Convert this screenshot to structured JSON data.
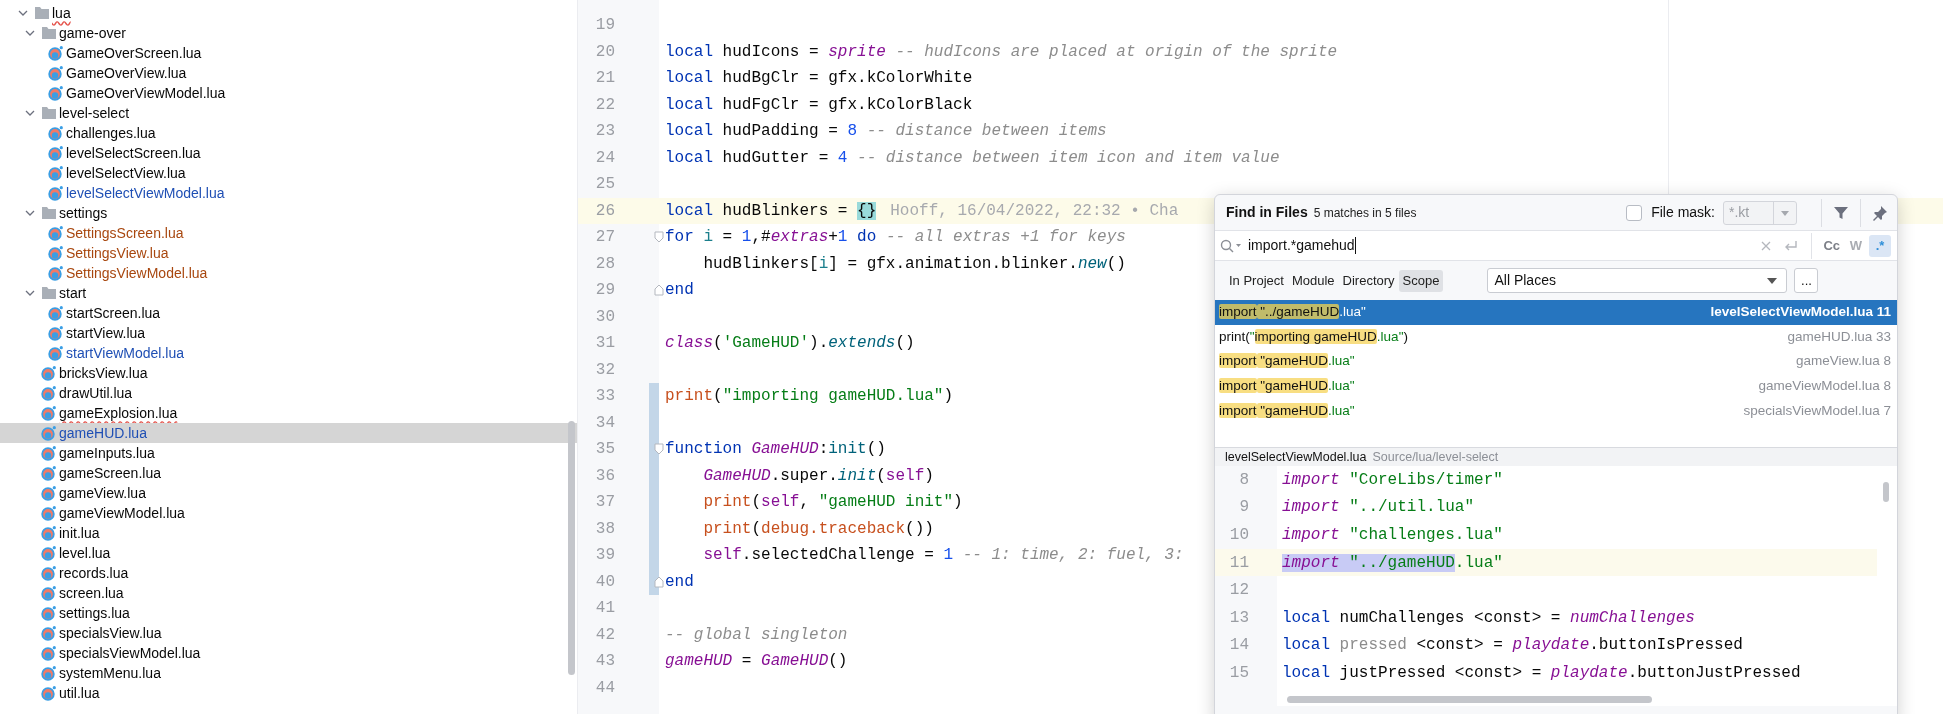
{
  "project_tree": [
    {
      "label": "lua",
      "kind": "folder",
      "expanded": true,
      "color": "#080808",
      "typo": true,
      "selected": false,
      "children": [
        {
          "label": "game-over",
          "kind": "folder",
          "expanded": true,
          "color": "#080808",
          "typo": false,
          "selected": false,
          "children": [
            {
              "label": "GameOverScreen.lua",
              "kind": "file",
              "color": "#080808",
              "typo": false,
              "selected": false
            },
            {
              "label": "GameOverView.lua",
              "kind": "file",
              "color": "#080808",
              "typo": false,
              "selected": false
            },
            {
              "label": "GameOverViewModel.lua",
              "kind": "file",
              "color": "#080808",
              "typo": false,
              "selected": false
            }
          ]
        },
        {
          "label": "level-select",
          "kind": "folder",
          "expanded": true,
          "color": "#080808",
          "typo": false,
          "selected": false,
          "children": [
            {
              "label": "challenges.lua",
              "kind": "file",
              "color": "#080808",
              "typo": false,
              "selected": false
            },
            {
              "label": "levelSelectScreen.lua",
              "kind": "file",
              "color": "#080808",
              "typo": false,
              "selected": false
            },
            {
              "label": "levelSelectView.lua",
              "kind": "file",
              "color": "#080808",
              "typo": false,
              "selected": false
            },
            {
              "label": "levelSelectViewModel.lua",
              "kind": "file",
              "color": "#1f4fb4",
              "typo": false,
              "selected": false
            }
          ]
        },
        {
          "label": "settings",
          "kind": "folder",
          "expanded": true,
          "color": "#080808",
          "typo": false,
          "selected": false,
          "children": [
            {
              "label": "SettingsScreen.lua",
              "kind": "file",
              "color": "#a8470f",
              "typo": false,
              "selected": false
            },
            {
              "label": "SettingsView.lua",
              "kind": "file",
              "color": "#a8470f",
              "typo": false,
              "selected": false
            },
            {
              "label": "SettingsViewModel.lua",
              "kind": "file",
              "color": "#a8470f",
              "typo": false,
              "selected": false
            }
          ]
        },
        {
          "label": "start",
          "kind": "folder",
          "expanded": true,
          "color": "#080808",
          "typo": false,
          "selected": false,
          "children": [
            {
              "label": "startScreen.lua",
              "kind": "file",
              "color": "#080808",
              "typo": false,
              "selected": false
            },
            {
              "label": "startView.lua",
              "kind": "file",
              "color": "#080808",
              "typo": false,
              "selected": false
            },
            {
              "label": "startViewModel.lua",
              "kind": "file",
              "color": "#1f4fb4",
              "typo": false,
              "selected": false
            }
          ]
        },
        {
          "label": "bricksView.lua",
          "kind": "file",
          "color": "#080808",
          "typo": false,
          "selected": false
        },
        {
          "label": "drawUtil.lua",
          "kind": "file",
          "color": "#080808",
          "typo": false,
          "selected": false
        },
        {
          "label": "gameExplosion.lua",
          "kind": "file",
          "color": "#080808",
          "typo": true,
          "selected": false
        },
        {
          "label": "gameHUD.lua",
          "kind": "file",
          "color": "#1f4fb4",
          "typo": false,
          "selected": true
        },
        {
          "label": "gameInputs.lua",
          "kind": "file",
          "color": "#080808",
          "typo": false,
          "selected": false
        },
        {
          "label": "gameScreen.lua",
          "kind": "file",
          "color": "#080808",
          "typo": false,
          "selected": false
        },
        {
          "label": "gameView.lua",
          "kind": "file",
          "color": "#080808",
          "typo": false,
          "selected": false
        },
        {
          "label": "gameViewModel.lua",
          "kind": "file",
          "color": "#080808",
          "typo": false,
          "selected": false
        },
        {
          "label": "init.lua",
          "kind": "file",
          "color": "#080808",
          "typo": false,
          "selected": false
        },
        {
          "label": "level.lua",
          "kind": "file",
          "color": "#080808",
          "typo": false,
          "selected": false
        },
        {
          "label": "records.lua",
          "kind": "file",
          "color": "#080808",
          "typo": false,
          "selected": false
        },
        {
          "label": "screen.lua",
          "kind": "file",
          "color": "#080808",
          "typo": false,
          "selected": false
        },
        {
          "label": "settings.lua",
          "kind": "file",
          "color": "#080808",
          "typo": false,
          "selected": false
        },
        {
          "label": "specialsView.lua",
          "kind": "file",
          "color": "#080808",
          "typo": false,
          "selected": false
        },
        {
          "label": "specialsViewModel.lua",
          "kind": "file",
          "color": "#080808",
          "typo": false,
          "selected": false
        },
        {
          "label": "systemMenu.lua",
          "kind": "file",
          "color": "#080808",
          "typo": false,
          "selected": false
        },
        {
          "label": "util.lua",
          "kind": "file",
          "color": "#080808",
          "typo": false,
          "selected": false
        }
      ]
    }
  ],
  "editor": {
    "lines": [
      {
        "number": "19",
        "current": false,
        "changed": false
      },
      {
        "number": "20",
        "current": false,
        "changed": false,
        "tokens": [
          {
            "kind": "keyword",
            "text": "local"
          },
          {
            "kind": "plain",
            "text": " hudIcons = "
          },
          {
            "kind": "global",
            "text": "sprite"
          },
          {
            "kind": "comment",
            "text": " -- hudIcons are placed at origin of the sprite"
          }
        ]
      },
      {
        "number": "21",
        "current": false,
        "changed": false,
        "tokens": [
          {
            "kind": "keyword",
            "text": "local"
          },
          {
            "kind": "plain",
            "text": " hudBgClr = gfx.kColorWhite"
          }
        ]
      },
      {
        "number": "22",
        "current": false,
        "changed": false,
        "tokens": [
          {
            "kind": "keyword",
            "text": "local"
          },
          {
            "kind": "plain",
            "text": " hudFgClr = gfx.kColorBlack"
          }
        ]
      },
      {
        "number": "23",
        "current": false,
        "changed": false,
        "tokens": [
          {
            "kind": "keyword",
            "text": "local"
          },
          {
            "kind": "plain",
            "text": " hudPadding = "
          },
          {
            "kind": "number",
            "text": "8"
          },
          {
            "kind": "comment",
            "text": " -- distance between items"
          }
        ]
      },
      {
        "number": "24",
        "current": false,
        "changed": false,
        "tokens": [
          {
            "kind": "keyword",
            "text": "local"
          },
          {
            "kind": "plain",
            "text": " hudGutter = "
          },
          {
            "kind": "number",
            "text": "4"
          },
          {
            "kind": "comment",
            "text": " -- distance between item icon and item value"
          }
        ]
      },
      {
        "number": "25",
        "current": false,
        "changed": false
      },
      {
        "number": "26",
        "current": true,
        "changed": false,
        "annotation": "Hooff, 16/04/2022, 22:32 • Cha",
        "tokens": [
          {
            "kind": "keyword",
            "text": "local"
          },
          {
            "kind": "plain",
            "text": " hudBlinkers = "
          },
          {
            "kind": "brace",
            "text": "{}"
          }
        ]
      },
      {
        "number": "27",
        "current": false,
        "changed": false,
        "fold_start": true,
        "fold_end": false,
        "tokens": [
          {
            "kind": "keyword",
            "text": "for"
          },
          {
            "kind": "local",
            "text": " i"
          },
          {
            "kind": "plain",
            "text": " = "
          },
          {
            "kind": "number",
            "text": "1"
          },
          {
            "kind": "plain",
            "text": ",#"
          },
          {
            "kind": "global",
            "text": "extras"
          },
          {
            "kind": "plain",
            "text": "+"
          },
          {
            "kind": "number",
            "text": "1"
          },
          {
            "kind": "keyword",
            "text": " do"
          },
          {
            "kind": "comment",
            "text": " -- all extras +1 for keys"
          }
        ]
      },
      {
        "number": "28",
        "current": false,
        "changed": false,
        "tokens": [
          {
            "kind": "plain",
            "text": "    hudBlinkers["
          },
          {
            "kind": "local",
            "text": "i"
          },
          {
            "kind": "plain",
            "text": "] = gfx.animation.blinker."
          },
          {
            "kind": "method",
            "text": "new"
          },
          {
            "kind": "plain",
            "text": "()"
          }
        ]
      },
      {
        "number": "29",
        "current": false,
        "changed": false,
        "fold_start": false,
        "fold_end": true,
        "tokens": [
          {
            "kind": "keyword",
            "text": "end"
          }
        ]
      },
      {
        "number": "30",
        "current": false,
        "changed": false
      },
      {
        "number": "31",
        "current": false,
        "changed": false,
        "tokens": [
          {
            "kind": "global",
            "text": "class"
          },
          {
            "kind": "plain",
            "text": "("
          },
          {
            "kind": "string",
            "text": "'GameHUD'"
          },
          {
            "kind": "plain",
            "text": ")."
          },
          {
            "kind": "method",
            "text": "extends"
          },
          {
            "kind": "plain",
            "text": "()"
          }
        ]
      },
      {
        "number": "32",
        "current": false,
        "changed": false
      },
      {
        "number": "33",
        "current": false,
        "changed": true,
        "tokens": [
          {
            "kind": "builtin",
            "text": "print"
          },
          {
            "kind": "plain",
            "text": "("
          },
          {
            "kind": "string",
            "text": "\"importing gameHUD.lua\""
          },
          {
            "kind": "plain",
            "text": ")"
          }
        ]
      },
      {
        "number": "34",
        "current": false,
        "changed": true
      },
      {
        "number": "35",
        "current": false,
        "changed": true,
        "fold_start": true,
        "fold_end": false,
        "tokens": [
          {
            "kind": "keyword",
            "text": "function"
          },
          {
            "kind": "global",
            "text": " GameHUD"
          },
          {
            "kind": "plain",
            "text": ":"
          },
          {
            "kind": "function",
            "text": "init"
          },
          {
            "kind": "plain",
            "text": "()"
          }
        ]
      },
      {
        "number": "36",
        "current": false,
        "changed": true,
        "tokens": [
          {
            "kind": "global",
            "text": "    GameHUD"
          },
          {
            "kind": "plain",
            "text": ".super."
          },
          {
            "kind": "method",
            "text": "init"
          },
          {
            "kind": "plain",
            "text": "("
          },
          {
            "kind": "self",
            "text": "self"
          },
          {
            "kind": "plain",
            "text": ")"
          }
        ]
      },
      {
        "number": "37",
        "current": false,
        "changed": true,
        "tokens": [
          {
            "kind": "builtin",
            "text": "    print"
          },
          {
            "kind": "plain",
            "text": "("
          },
          {
            "kind": "self",
            "text": "self"
          },
          {
            "kind": "plain",
            "text": ", "
          },
          {
            "kind": "string",
            "text": "\"gameHUD init\""
          },
          {
            "kind": "plain",
            "text": ")"
          }
        ]
      },
      {
        "number": "38",
        "current": false,
        "changed": true,
        "tokens": [
          {
            "kind": "builtin",
            "text": "    print"
          },
          {
            "kind": "plain",
            "text": "("
          },
          {
            "kind": "builtin",
            "text": "debug.traceback"
          },
          {
            "kind": "plain",
            "text": "())"
          }
        ]
      },
      {
        "number": "39",
        "current": false,
        "changed": true,
        "tokens": [
          {
            "kind": "self",
            "text": "    self"
          },
          {
            "kind": "plain",
            "text": ".selectedChallenge = "
          },
          {
            "kind": "number",
            "text": "1"
          },
          {
            "kind": "comment",
            "text": " -- 1: time, 2: fuel, 3:"
          }
        ]
      },
      {
        "number": "40",
        "current": false,
        "changed": true,
        "fold_start": false,
        "fold_end": true,
        "tokens": [
          {
            "kind": "keyword",
            "text": "end"
          }
        ]
      },
      {
        "number": "41",
        "current": false,
        "changed": false
      },
      {
        "number": "42",
        "current": false,
        "changed": false,
        "tokens": [
          {
            "kind": "comment",
            "text": "-- global singleton"
          }
        ]
      },
      {
        "number": "43",
        "current": false,
        "changed": false,
        "tokens": [
          {
            "kind": "global",
            "text": "gameHUD"
          },
          {
            "kind": "plain",
            "text": " = "
          },
          {
            "kind": "global",
            "text": "GameHUD"
          },
          {
            "kind": "plain",
            "text": "()"
          }
        ]
      },
      {
        "number": "44",
        "current": false,
        "changed": false
      }
    ]
  },
  "find_dialog": {
    "title": "Find in Files",
    "summary": "5 matches in 5 files",
    "file_mask": {
      "label": "File mask:",
      "checked": false,
      "value": "*.kt"
    },
    "query": "import.*gamehud",
    "options": [
      {
        "label": "Cc",
        "selected": false,
        "disabled": false
      },
      {
        "label": "W",
        "selected": false,
        "disabled": true
      },
      {
        "label": ".*",
        "selected": true,
        "disabled": false
      }
    ],
    "scopes": [
      {
        "label": "In Project",
        "selected": false
      },
      {
        "label": "Module",
        "selected": false
      },
      {
        "label": "Directory",
        "selected": false
      },
      {
        "label": "Scope",
        "selected": true
      }
    ],
    "scope_value": "All Places",
    "more_button": "...",
    "results": [
      {
        "selected": true,
        "location": "levelSelectViewModel.lua 11",
        "segments": [
          {
            "kind": "match",
            "text": "import"
          },
          {
            "kind": "match",
            "text": " \"../gameHUD"
          },
          {
            "kind": "string",
            "text": ".lua\""
          }
        ]
      },
      {
        "selected": false,
        "location": "gameHUD.lua 33",
        "segments": [
          {
            "kind": "code",
            "text": "print("
          },
          {
            "kind": "string",
            "text": "\""
          },
          {
            "kind": "match",
            "text": "importing gameHUD"
          },
          {
            "kind": "string",
            "text": ".lua\""
          },
          {
            "kind": "code",
            "text": ")"
          }
        ]
      },
      {
        "selected": false,
        "location": "gameView.lua 8",
        "segments": [
          {
            "kind": "match",
            "text": "import"
          },
          {
            "kind": "match",
            "text": " \"gameHUD"
          },
          {
            "kind": "string",
            "text": ".lua\""
          }
        ]
      },
      {
        "selected": false,
        "location": "gameViewModel.lua 8",
        "segments": [
          {
            "kind": "match",
            "text": "import"
          },
          {
            "kind": "match",
            "text": " \"gameHUD"
          },
          {
            "kind": "string",
            "text": ".lua\""
          }
        ]
      },
      {
        "selected": false,
        "location": "specialsViewModel.lua 7",
        "segments": [
          {
            "kind": "match",
            "text": "import"
          },
          {
            "kind": "match",
            "text": " \"gameHUD"
          },
          {
            "kind": "string",
            "text": ".lua\""
          }
        ]
      }
    ],
    "preview": {
      "file": "levelSelectViewModel.lua",
      "path": "Source/lua/level-select",
      "lines": [
        {
          "number": "8",
          "current": false,
          "tokens": [
            {
              "kind": "global",
              "text": "import"
            },
            {
              "kind": "string",
              "text": " \"CoreLibs/timer\""
            }
          ]
        },
        {
          "number": "9",
          "current": false,
          "tokens": [
            {
              "kind": "global",
              "text": "import"
            },
            {
              "kind": "string",
              "text": " \"../util.lua\""
            }
          ]
        },
        {
          "number": "10",
          "current": false,
          "tokens": [
            {
              "kind": "global",
              "text": "import"
            },
            {
              "kind": "string",
              "text": " \"challenges.lua\""
            }
          ]
        },
        {
          "number": "11",
          "current": true,
          "tokens": [
            {
              "kind": "global",
              "text": "import",
              "selected": true
            },
            {
              "kind": "string",
              "text": " \"../gameHUD",
              "selected": true
            },
            {
              "kind": "string",
              "text": ".lua\"",
              "selected": false
            }
          ]
        },
        {
          "number": "12",
          "current": false
        },
        {
          "number": "13",
          "current": false,
          "tokens": [
            {
              "kind": "keyword",
              "text": "local"
            },
            {
              "kind": "plain",
              "text": " numChallenges <const> = "
            },
            {
              "kind": "global",
              "text": "numChallenges"
            }
          ]
        },
        {
          "number": "14",
          "current": false,
          "tokens": [
            {
              "kind": "keyword",
              "text": "local"
            },
            {
              "kind": "unused",
              "text": " pressed"
            },
            {
              "kind": "plain",
              "text": " <const> = "
            },
            {
              "kind": "global",
              "text": "playdate"
            },
            {
              "kind": "plain",
              "text": ".buttonIsPressed"
            }
          ]
        },
        {
          "number": "15",
          "current": false,
          "tokens": [
            {
              "kind": "keyword",
              "text": "local"
            },
            {
              "kind": "plain",
              "text": " justPressed <const> = "
            },
            {
              "kind": "global",
              "text": "playdate"
            },
            {
              "kind": "plain",
              "text": ".buttonJustPressed"
            }
          ]
        }
      ]
    }
  }
}
